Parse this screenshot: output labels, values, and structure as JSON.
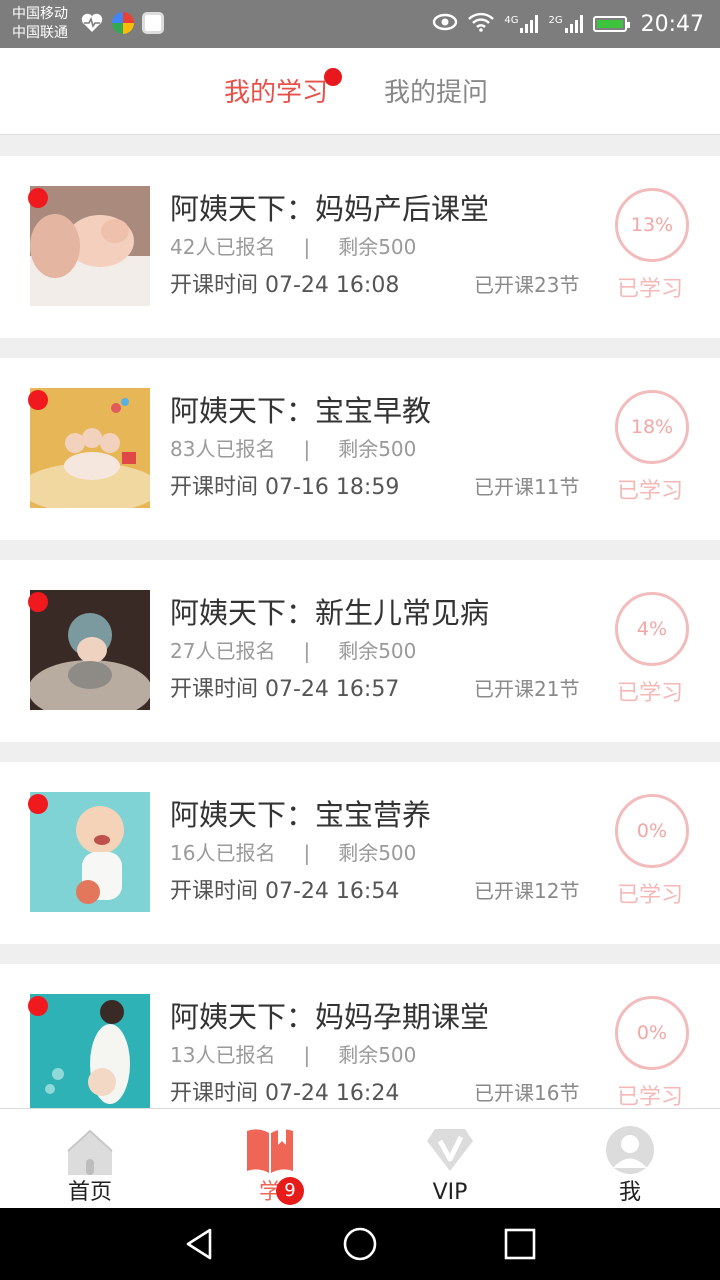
{
  "status_bar": {
    "carrier_1": "中国移动",
    "carrier_2": "中国联通",
    "net_1": "4G",
    "net_2": "2G",
    "time": "20:47",
    "icons": [
      "heartbeat-icon",
      "app-icon",
      "app-icon",
      "eye-icon",
      "wifi-icon",
      "signal-icon",
      "signal-icon",
      "battery-icon"
    ]
  },
  "tabs": {
    "active_label": "我的学习",
    "inactive_label": "我的提问"
  },
  "courses": [
    {
      "title": "阿姨天下：妈妈产后课堂",
      "enrolled": "42人已报名",
      "sep": "|",
      "remaining": "剩余500",
      "time": "开课时间 07-24 16:08",
      "lessons": "已开课23节",
      "progress": "13%",
      "progress_value": 0.13,
      "status": "已学习"
    },
    {
      "title": "阿姨天下：宝宝早教",
      "enrolled": "83人已报名",
      "sep": "|",
      "remaining": "剩余500",
      "time": "开课时间 07-16 18:59",
      "lessons": "已开课11节",
      "progress": "18%",
      "progress_value": 0.18,
      "status": "已学习"
    },
    {
      "title": "阿姨天下：新生儿常见病",
      "enrolled": "27人已报名",
      "sep": "|",
      "remaining": "剩余500",
      "time": "开课时间 07-24 16:57",
      "lessons": "已开课21节",
      "progress": "4%",
      "progress_value": 0.04,
      "status": "已学习"
    },
    {
      "title": "阿姨天下：宝宝营养",
      "enrolled": "16人已报名",
      "sep": "|",
      "remaining": "剩余500",
      "time": "开课时间 07-24 16:54",
      "lessons": "已开课12节",
      "progress": "0%",
      "progress_value": 0,
      "status": "已学习"
    },
    {
      "title": "阿姨天下：妈妈孕期课堂",
      "enrolled": "13人已报名",
      "sep": "|",
      "remaining": "剩余500",
      "time": "开课时间 07-24 16:24",
      "lessons": "已开课16节",
      "progress": "0%",
      "progress_value": 0,
      "status": "已学习"
    }
  ],
  "bottom_nav": {
    "home": "首页",
    "study": "学",
    "study_badge": "9",
    "vip": "VIP",
    "me": "我"
  },
  "colors": {
    "accent": "#e8514a",
    "unread_dot": "#f0191e",
    "progress_ring": "#f2bcbc",
    "learned_text": "#f4b8b6",
    "nav_active": "#f06656"
  }
}
